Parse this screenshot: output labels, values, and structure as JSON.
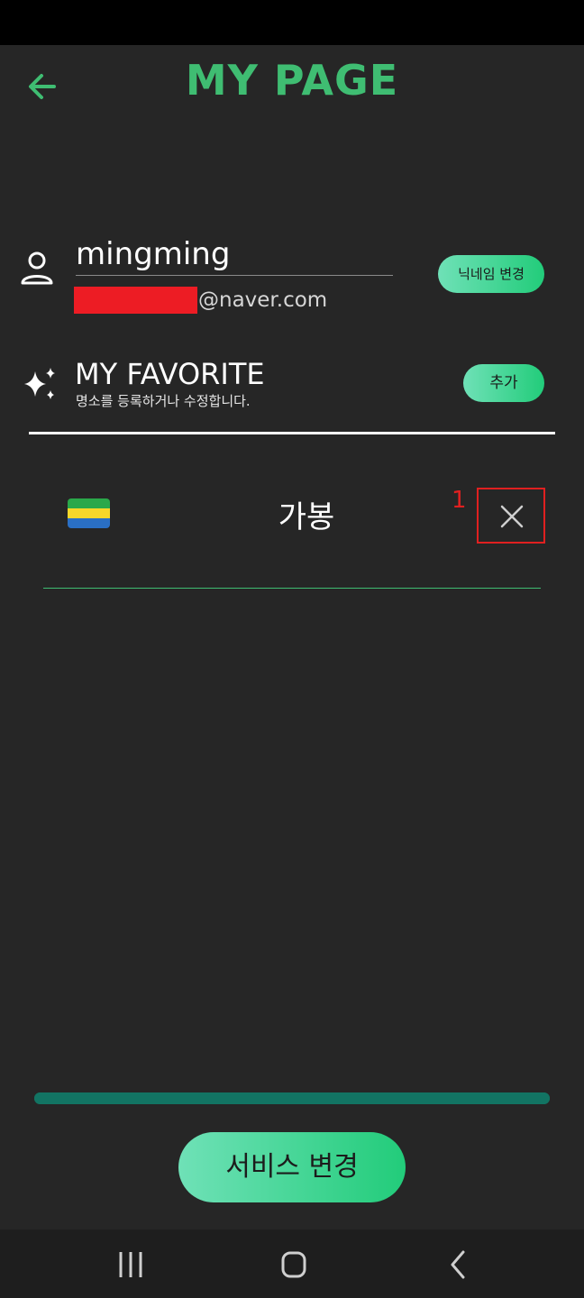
{
  "header": {
    "title": "MY PAGE",
    "back_icon": "arrow-left-icon"
  },
  "profile": {
    "icon": "person-icon",
    "nickname": "mingming",
    "email_visible": "@naver.com",
    "email_redacted": true,
    "nickname_button": "닉네임 변경"
  },
  "favorites": {
    "icon": "sparkle-icon",
    "title": "MY FAVORITE",
    "subtitle": "명소를 등록하거나 수정합니다.",
    "add_button": "추가",
    "items": [
      {
        "flag": "gabon-flag-icon",
        "name": "가봉",
        "marker": "1",
        "delete_icon": "close-icon"
      }
    ]
  },
  "progress": {
    "value": 1.0
  },
  "service_button": "서비스 변경",
  "nav": {
    "recent": "recent-apps-icon",
    "home": "home-icon",
    "back": "back-chevron-icon"
  },
  "colors": {
    "background": "#262626",
    "accent": "#3fbd72",
    "button_gradient_start": "#6fe1b7",
    "button_gradient_end": "#22cc7a",
    "annotation_red": "#e02020",
    "progress": "#127463"
  }
}
